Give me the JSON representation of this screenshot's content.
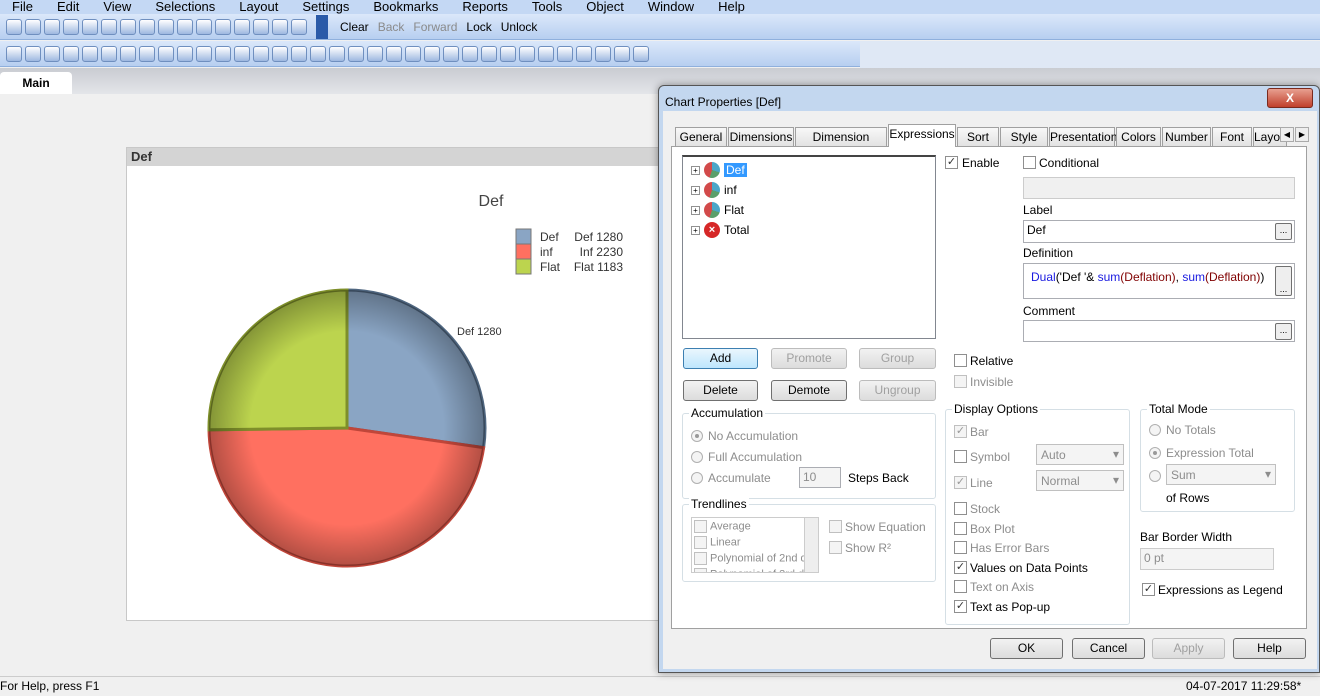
{
  "menu": [
    "File",
    "Edit",
    "View",
    "Selections",
    "Layout",
    "Settings",
    "Bookmarks",
    "Reports",
    "Tools",
    "Object",
    "Window",
    "Help"
  ],
  "toolbar1": {
    "icons_a": [
      "new-icon",
      "open-icon",
      "reload-icon",
      "save-icon",
      "print-icon",
      "edit-script-icon",
      "reload-data-icon",
      "undo-icon",
      "redo-icon",
      "search-icon",
      "checkmark-icon",
      "chart-wizard-icon",
      "bookmark-star-icon",
      "edit-icon",
      "help-icon",
      "context-help-icon"
    ],
    "clear": "Clear",
    "back": "Back",
    "forward": "Forward",
    "lock": "Lock",
    "unlock": "Unlock"
  },
  "toolbar2": {
    "icons": [
      "new-sheet-icon",
      "sheet-left-icon",
      "sheet-right-icon",
      "sheet-props-icon",
      "listbox-icon",
      "statistics-icon",
      "table-box-icon",
      "multibox-icon",
      "chart-icon",
      "input-box-icon",
      "current-selections-icon",
      "button-icon",
      "text-object-icon",
      "line-icon",
      "slider-icon",
      "bookmark-object-icon",
      "search-object-icon",
      "container-icon",
      "custom-object-icon",
      "chart-wizard-icon",
      "format-painter-icon",
      "grid-icon",
      "align-left-icon",
      "align-center-icon",
      "align-right-icon",
      "align-bottom-icon",
      "center-h-icon",
      "align-top-icon",
      "space-icon",
      "export-icon",
      "properties-icon",
      "edit-icon",
      "network-icon",
      "server-icon"
    ]
  },
  "sheet_tab": "Main",
  "chart": {
    "caption": "Def",
    "pie_label": "Def 1280"
  },
  "chart_data": {
    "type": "pie",
    "title": "Def",
    "slices": [
      {
        "name": "Def",
        "label": "Def 1280",
        "value": 1280,
        "color": "#8aa5c4"
      },
      {
        "name": "inf",
        "label": "Inf 2230",
        "value": 2230,
        "color": "#ff7060"
      },
      {
        "name": "Flat",
        "label": "Flat 1183",
        "value": 1183,
        "color": "#bcd44e"
      }
    ],
    "legend": "top-right"
  },
  "status": {
    "help": "For Help, press F1",
    "datetime": "04-07-2017 11:29:58*"
  },
  "dialog": {
    "title": "Chart Properties [Def]",
    "close": "X",
    "tabs": [
      "General",
      "Dimensions",
      "Dimension Limits",
      "Expressions",
      "Sort",
      "Style",
      "Presentation",
      "Colors",
      "Number",
      "Font",
      "Layout"
    ],
    "expressions": [
      "Def",
      "inf",
      "Flat",
      "Total"
    ],
    "enable": "Enable",
    "conditional": "Conditional",
    "label_title": "Label",
    "label_value": "Def",
    "definition_title": "Definition",
    "definition": {
      "f1": "Dual",
      "p1": "('Def '& ",
      "f2": "sum",
      "a1": "(Deflation)",
      "c": ", ",
      "f3": "sum",
      "a2": "(Deflation)",
      "p2": ")"
    },
    "comment_title": "Comment",
    "ellipsis": "...",
    "add": "Add",
    "promote": "Promote",
    "group": "Group",
    "delete": "Delete",
    "demote": "Demote",
    "ungroup": "Ungroup",
    "relative": "Relative",
    "invisible": "Invisible",
    "accumulation": {
      "title": "Accumulation",
      "no": "No Accumulation",
      "full": "Full Accumulation",
      "acc": "Accumulate",
      "steps": "10",
      "steps_back": "Steps Back"
    },
    "trendlines": {
      "title": "Trendlines",
      "items": [
        "Average",
        "Linear",
        "Polynomial of 2nd d",
        "Polynomial of 3rd d"
      ],
      "show_eq": "Show Equation",
      "show_r2": "Show R²"
    },
    "display": {
      "title": "Display Options",
      "bar": "Bar",
      "symbol": "Symbol",
      "symbol_val": "Auto",
      "line": "Line",
      "line_val": "Normal",
      "stock": "Stock",
      "box": "Box Plot",
      "err": "Has Error Bars",
      "values": "Values on Data Points",
      "axis": "Text on Axis",
      "popup": "Text as Pop-up"
    },
    "total": {
      "title": "Total Mode",
      "no": "No Totals",
      "expr": "Expression Total",
      "sum": "Sum",
      "rows": "of Rows"
    },
    "border": {
      "title": "Bar Border Width",
      "value": "0 pt"
    },
    "legend_cb": "Expressions as Legend",
    "ok": "OK",
    "cancel": "Cancel",
    "apply": "Apply",
    "help": "Help"
  }
}
